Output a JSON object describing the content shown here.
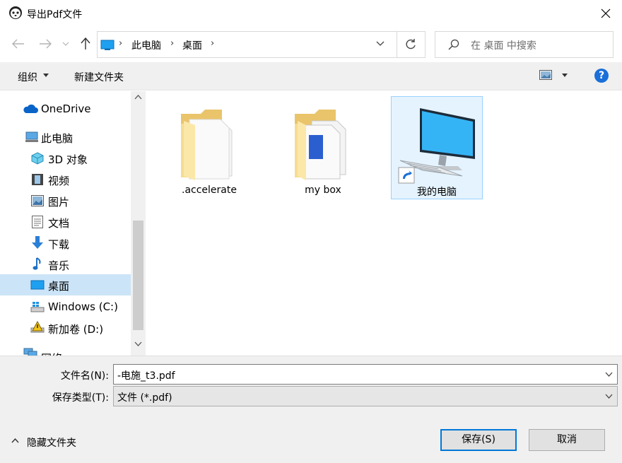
{
  "window": {
    "title": "导出Pdf文件"
  },
  "address": {
    "crumbs": [
      "此电脑",
      "桌面"
    ]
  },
  "search": {
    "placeholder": "在 桌面 中搜索"
  },
  "toolbar": {
    "organize": "组织",
    "new_folder": "新建文件夹",
    "help": "?"
  },
  "sidebar": {
    "items": [
      {
        "label": "OneDrive",
        "icon": "cloud-icon"
      },
      {
        "label": "此电脑",
        "icon": "computer-icon"
      },
      {
        "label": "3D 对象",
        "icon": "cube-icon"
      },
      {
        "label": "视频",
        "icon": "video-icon"
      },
      {
        "label": "图片",
        "icon": "picture-icon"
      },
      {
        "label": "文档",
        "icon": "document-icon"
      },
      {
        "label": "下载",
        "icon": "download-icon"
      },
      {
        "label": "音乐",
        "icon": "music-icon"
      },
      {
        "label": "桌面",
        "icon": "desktop-icon",
        "selected": true
      },
      {
        "label": "Windows (C:)",
        "icon": "drive-icon"
      },
      {
        "label": "新加卷 (D:)",
        "icon": "drive-icon"
      },
      {
        "label": "网络",
        "icon": "network-icon"
      }
    ]
  },
  "files": [
    {
      "name": ".accelerate",
      "icon": "folder-icon"
    },
    {
      "name": "my box",
      "icon": "folder-icon"
    },
    {
      "name": "我的电脑",
      "icon": "computer-shortcut-icon",
      "selected": true
    }
  ],
  "form": {
    "filename_label": "文件名(N):",
    "filename_value": "-电施_t3.pdf",
    "filetype_label": "保存类型(T):",
    "filetype_value": "文件 (*.pdf)"
  },
  "footer": {
    "hide_folders": "隐藏文件夹",
    "save": "保存(S)",
    "cancel": "取消"
  },
  "colors": {
    "accent": "#0078d7",
    "selection": "#cce4f7",
    "file_selection": "#e5f3ff"
  }
}
